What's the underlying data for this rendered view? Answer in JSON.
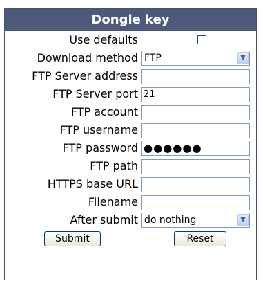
{
  "header": {
    "title": "Dongle key"
  },
  "form": {
    "use_defaults": {
      "label": "Use defaults",
      "checked": false
    },
    "download_method": {
      "label": "Download method",
      "value": "FTP"
    },
    "ftp_server_address": {
      "label": "FTP Server address",
      "value": ""
    },
    "ftp_server_port": {
      "label": "FTP Server port",
      "value": "21"
    },
    "ftp_account": {
      "label": "FTP account",
      "value": ""
    },
    "ftp_username": {
      "label": "FTP username",
      "value": ""
    },
    "ftp_password": {
      "label": "FTP password",
      "value": "●●●●●●"
    },
    "ftp_path": {
      "label": "FTP path",
      "value": ""
    },
    "https_base_url": {
      "label": "HTTPS base URL",
      "value": ""
    },
    "filename": {
      "label": "Filename",
      "value": ""
    },
    "after_submit": {
      "label": "After submit",
      "value": "do nothing"
    }
  },
  "buttons": {
    "submit": "Submit",
    "reset": "Reset"
  },
  "icons": {
    "dropdown": "chevron-down-icon",
    "checkbox": "checkbox-icon"
  },
  "colors": {
    "header_bg": "#4d5a7c",
    "border": "#44516f",
    "input_border": "#7f9db9"
  }
}
